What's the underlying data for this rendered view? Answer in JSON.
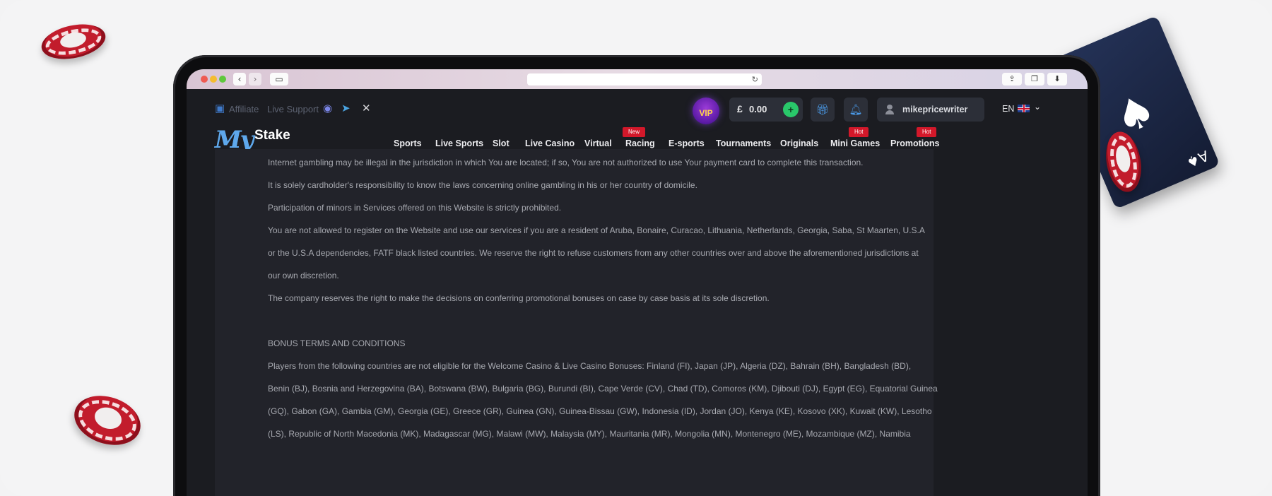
{
  "browser": {
    "back_icon": "chevron-left-icon",
    "forward_icon": "chevron-right-icon",
    "sidebar_icon": "sidebar-icon",
    "reload_icon": "reload-icon",
    "share_icon": "share-icon",
    "tabs_icon": "tabs-icon",
    "download_icon": "download-icon"
  },
  "top_bar": {
    "affiliate": "Affiliate",
    "live_support": "Live Support",
    "social": [
      "discord-icon",
      "telegram-icon",
      "x-icon"
    ],
    "vip": "VIP",
    "currency": "£",
    "balance": "0.00",
    "add": "+",
    "gift_icon": "gift-icon",
    "bell_icon": "bell-icon",
    "username": "mikepricewriter",
    "language": "EN"
  },
  "logo": {
    "my": "My",
    "stake": "Stake"
  },
  "nav": {
    "items": [
      {
        "label": "Sports",
        "tag": ""
      },
      {
        "label": "Live Sports",
        "tag": ""
      },
      {
        "label": "Slot",
        "tag": ""
      },
      {
        "label": "Live Casino",
        "tag": ""
      },
      {
        "label": "Virtual",
        "tag": ""
      },
      {
        "label": "Racing",
        "tag": "New"
      },
      {
        "label": "E-sports",
        "tag": ""
      },
      {
        "label": "Tournaments",
        "tag": ""
      },
      {
        "label": "Originals",
        "tag": ""
      },
      {
        "label": "Mini Games",
        "tag": "Hot"
      },
      {
        "label": "Promotions",
        "tag": "Hot"
      }
    ]
  },
  "content": {
    "paragraphs": [
      "Internet gambling may be illegal in the jurisdiction in which You are located; if so, You are not authorized to use Your payment card to complete this transaction.",
      "It is solely cardholder's responsibility to know the laws concerning online gambling in his or her country of domicile.",
      "Participation of minors in Services offered on this Website is strictly prohibited.",
      "You are not allowed to register on the Website and use our services if you are a resident of Aruba, Bonaire, Curacao, Lithuania, Netherlands, Georgia, Saba, St Maarten, U.S.A",
      "or the U.S.A dependencies, FATF black listed countries. We reserve the right to refuse customers from any other countries over and above the aforementioned jurisdictions at",
      "our own discretion.",
      "The company reserves the right to make the decisions on conferring promotional bonuses on case by case basis at its sole discretion."
    ],
    "bonus_heading": "BONUS TERMS AND CONDITIONS",
    "bonus_paragraphs": [
      "Players from the following countries are not eligible for the Welcome Casino & Live Casino Bonuses: Finland (FI), Japan (JP), Algeria (DZ), Bahrain (BH), Bangladesh (BD),",
      "Benin (BJ), Bosnia and Herzegovina (BA), Botswana (BW), Bulgaria (BG), Burundi (BI), Cape Verde (CV), Chad (TD), Comoros (KM), Djibouti (DJ), Egypt (EG), Equatorial Guinea",
      "(GQ), Gabon (GA), Gambia (GM), Georgia (GE), Greece (GR), Guinea (GN), Guinea-Bissau (GW), Indonesia (ID), Jordan (JO), Kenya (KE), Kosovo (XK), Kuwait (KW), Lesotho",
      "(LS), Republic of North Macedonia (MK), Madagascar (MG), Malawi (MW), Malaysia (MY), Mauritania (MR), Mongolia (MN), Montenegro (ME), Mozambique (MZ), Namibia"
    ]
  },
  "colors": {
    "accent_green": "#29c86a",
    "tag_red": "#d3182a",
    "logo_blue": "#5ea8ec",
    "page_bg": "#1b1c21"
  }
}
